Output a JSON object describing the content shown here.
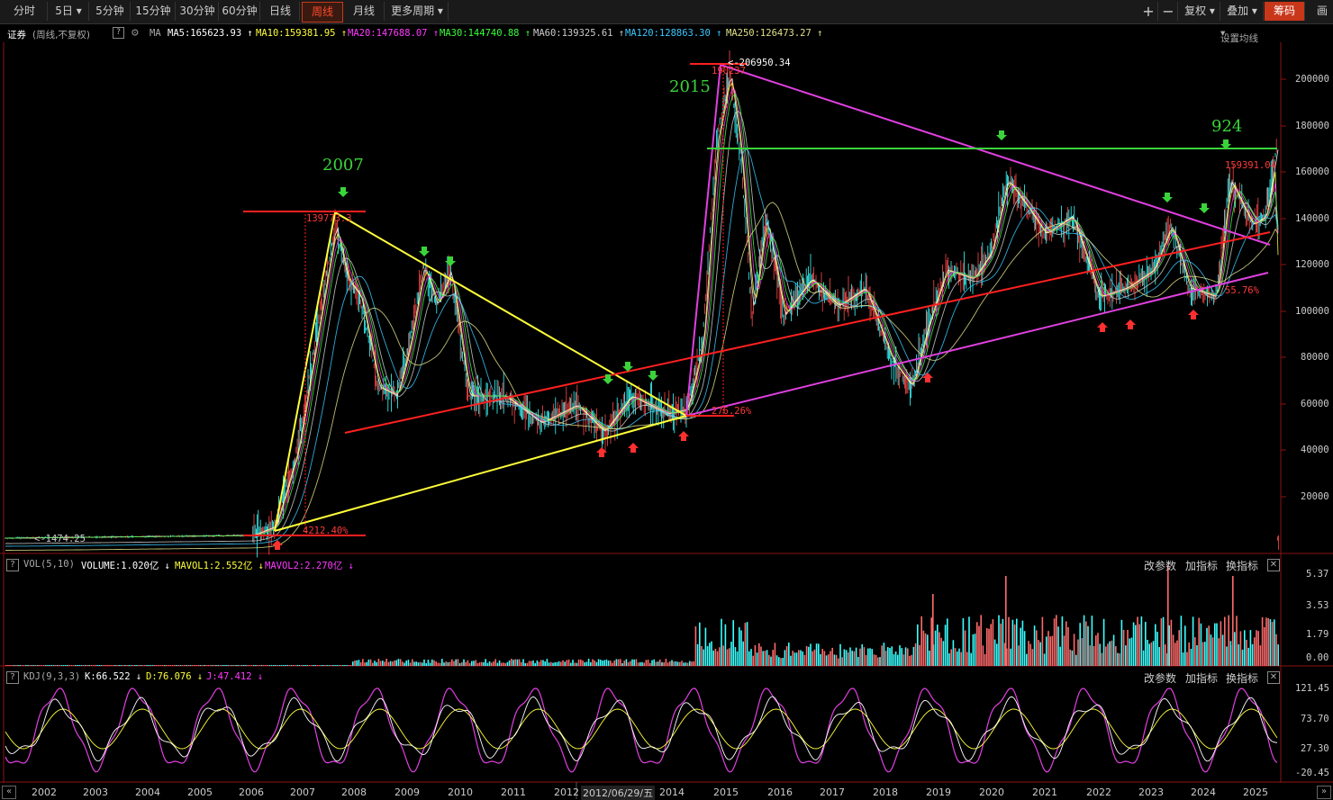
{
  "toolbar": {
    "tabs": [
      "分时",
      "5日",
      "5分钟",
      "15分钟",
      "30分钟",
      "60分钟",
      "日线",
      "周线",
      "月线",
      "更多周期"
    ],
    "active_tab": "周线",
    "right": {
      "plus": "+",
      "minus": "−",
      "fuquan": "复权",
      "diejia": "叠加",
      "chouma": "筹码",
      "draw": "画"
    }
  },
  "infobar": {
    "name": "证券",
    "subtitle": "(周线,不复权)",
    "ma_label": "MA",
    "ma5": "MA5:165623.93 ↑",
    "ma10": "MA10:159381.95 ↑",
    "ma20": "MA20:147688.07 ↑",
    "ma30": "MA30:144740.88 ↑",
    "ma60": "MA60:139325.61 ↑",
    "ma120": "MA120:128863.30 ↑",
    "ma250": "MA250:126473.27 ↑",
    "settings": "设置均线"
  },
  "colors": {
    "ma5": "#ffffff",
    "ma10": "#ffff3a",
    "ma20": "#ff3aff",
    "ma30": "#3aff3a",
    "ma60": "#cccccc",
    "ma120": "#3ac8ff",
    "ma250": "#e0e088",
    "up": "#ff4a4a",
    "down": "#3affff",
    "grid": "#8b1414",
    "magenta": "#e040e0",
    "yellow": "#ffff3a",
    "red": "#ff2020",
    "green": "#3ad43a"
  },
  "price_axis": [
    "200000",
    "180000",
    "160000",
    "140000",
    "120000",
    "100000",
    "80000",
    "60000",
    "40000",
    "20000"
  ],
  "annotations": {
    "y2007": "2007",
    "y2015": "2015",
    "y924": "924",
    "high2007": "139773.3",
    "high2015": "190237",
    "peak": "206950.34",
    "current": "159391.04",
    "low_start": "1474.25",
    "pct1": "4212.40%",
    "pct2": "276.26%",
    "pct3": "55.76%"
  },
  "volume": {
    "label": "VOL(5,10)",
    "volume": "VOLUME:1.020亿 ↓",
    "mavol1": "MAVOL1:2.552亿 ↓",
    "mavol2": "MAVOL2:2.270亿 ↓",
    "axis": [
      "5.37",
      "3.53",
      "1.79",
      "0.00"
    ],
    "btns": [
      "改参数",
      "加指标",
      "换指标"
    ]
  },
  "kdj": {
    "label": "KDJ(9,3,3)",
    "k": "K:66.522 ↓",
    "d": "D:76.076 ↓",
    "j": "J:47.412 ↓",
    "axis": [
      "121.45",
      "73.70",
      "27.30",
      "-20.45"
    ],
    "btns": [
      "改参数",
      "加指标",
      "换指标"
    ]
  },
  "years": [
    "2002",
    "2003",
    "2004",
    "2005",
    "2006",
    "2007",
    "2008",
    "2009",
    "2010",
    "2011",
    "2012",
    "2012/06/29/五",
    "2014",
    "2015",
    "2016",
    "2017",
    "2018",
    "2019",
    "2020",
    "2021",
    "2022",
    "2023",
    "2024",
    "2025"
  ]
}
